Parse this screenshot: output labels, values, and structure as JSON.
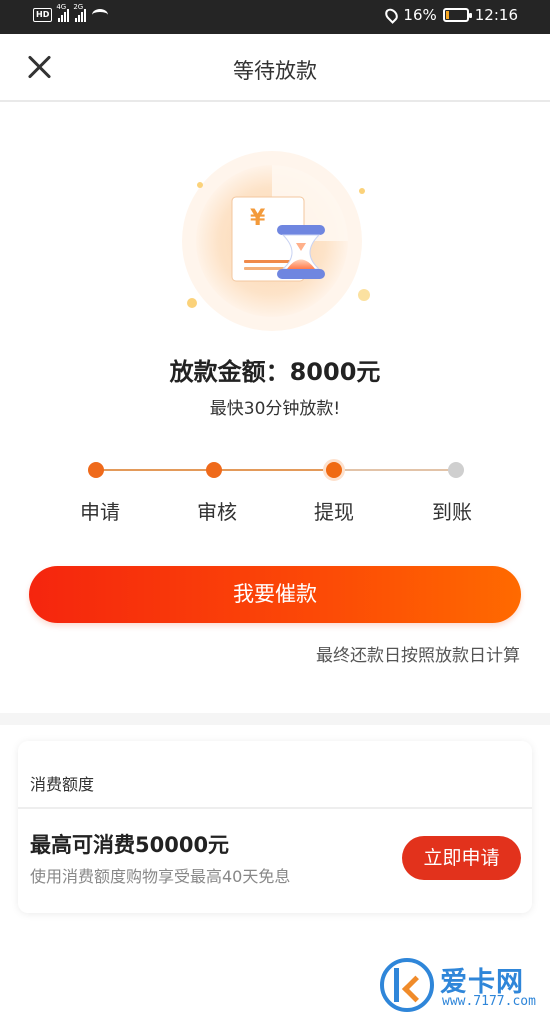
{
  "status_bar": {
    "hd": "HD",
    "net1": "4G",
    "net2": "2G",
    "battery_percent": "16%",
    "battery_level": 0.16,
    "time": "12:16"
  },
  "header": {
    "title": "等待放款",
    "close_icon": "close-icon"
  },
  "summary": {
    "amount_line": "放款金额：8000元",
    "sub_line": "最快30分钟放款!"
  },
  "illustration": {
    "currency_symbol": "¥",
    "icon": "hourglass-document-icon"
  },
  "progress": {
    "steps": [
      {
        "label": "申请",
        "state": "done"
      },
      {
        "label": "审核",
        "state": "done"
      },
      {
        "label": "提现",
        "state": "current"
      },
      {
        "label": "到账",
        "state": "pending"
      }
    ]
  },
  "actions": {
    "urge_label": "我要催款",
    "note": "最终还款日按照放款日计算"
  },
  "credit_card": {
    "title": "消费额度",
    "headline": "最高可消费50000元",
    "description": "使用消费额度购物享受最高40天免息",
    "apply_label": "立即申请"
  },
  "watermark": {
    "text": "爱卡网",
    "url": "www.7177.com"
  },
  "colors": {
    "accent": "#f5250e",
    "accent_end": "#ff6a00",
    "step_done": "#ef6a1b",
    "step_pending": "#cfcfcf",
    "apply_button": "#e2321c",
    "watermark_blue": "#2f86d9"
  }
}
